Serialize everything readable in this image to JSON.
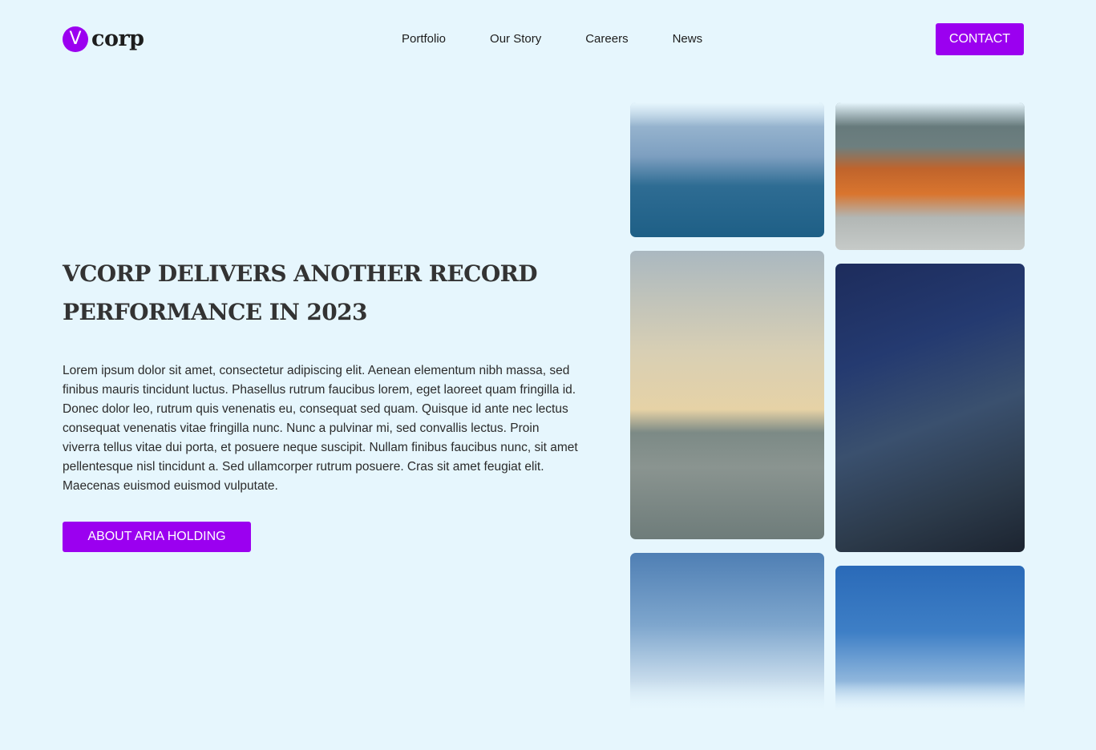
{
  "header": {
    "logo_mark": "V",
    "logo_text": "corp",
    "nav": [
      "Portfolio",
      "Our Story",
      "Careers",
      "News"
    ],
    "contact_label": "CONTACT"
  },
  "hero": {
    "headline": "VCORP DELIVERS ANOTHER RECORD PERFORMANCE IN 2023",
    "body": "Lorem ipsum dolor sit amet, consectetur adipiscing elit. Aenean elementum nibh massa, sed finibus mauris tincidunt luctus. Phasellus rutrum faucibus lorem, eget laoreet quam fringilla id. Donec dolor leo, rutrum quis venenatis eu, consequat sed quam. Quisque id ante nec lectus consequat venenatis vitae fringilla nunc. Nunc a pulvinar mi, sed convallis lectus. Proin viverra tellus vitae dui porta, et posuere neque suscipit. Nullam finibus faucibus nunc, sit amet pellentesque nisl tincidunt a. Sed ullamcorper rutrum posuere. Cras sit amet feugiat elit. Maecenas euismod euismod vulputate.",
    "button_label": "ABOUT ARIA HOLDING"
  },
  "colors": {
    "accent": "#9b00f0",
    "background": "#e6f6fd"
  }
}
